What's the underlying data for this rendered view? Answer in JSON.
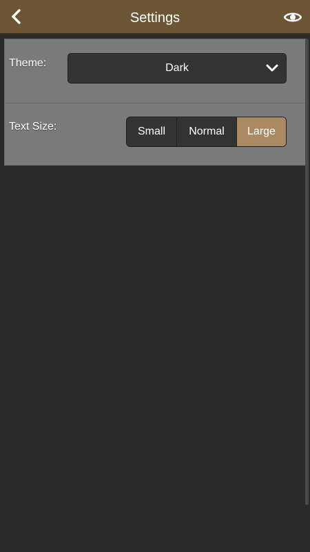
{
  "header": {
    "title": "Settings",
    "back_icon": "chevron-left-icon",
    "visibility_icon": "eye-icon"
  },
  "settings": {
    "theme": {
      "label": "Theme:",
      "value": "Dark"
    },
    "text_size": {
      "label": "Text Size:",
      "options": [
        "Small",
        "Normal",
        "Large"
      ],
      "selected": "Large"
    }
  },
  "colors": {
    "header_bg": "#6b5535",
    "page_bg": "#2a2a2a",
    "panel_bg": "#7a7a7a",
    "control_bg": "#333333",
    "accent": "#a98a63"
  }
}
